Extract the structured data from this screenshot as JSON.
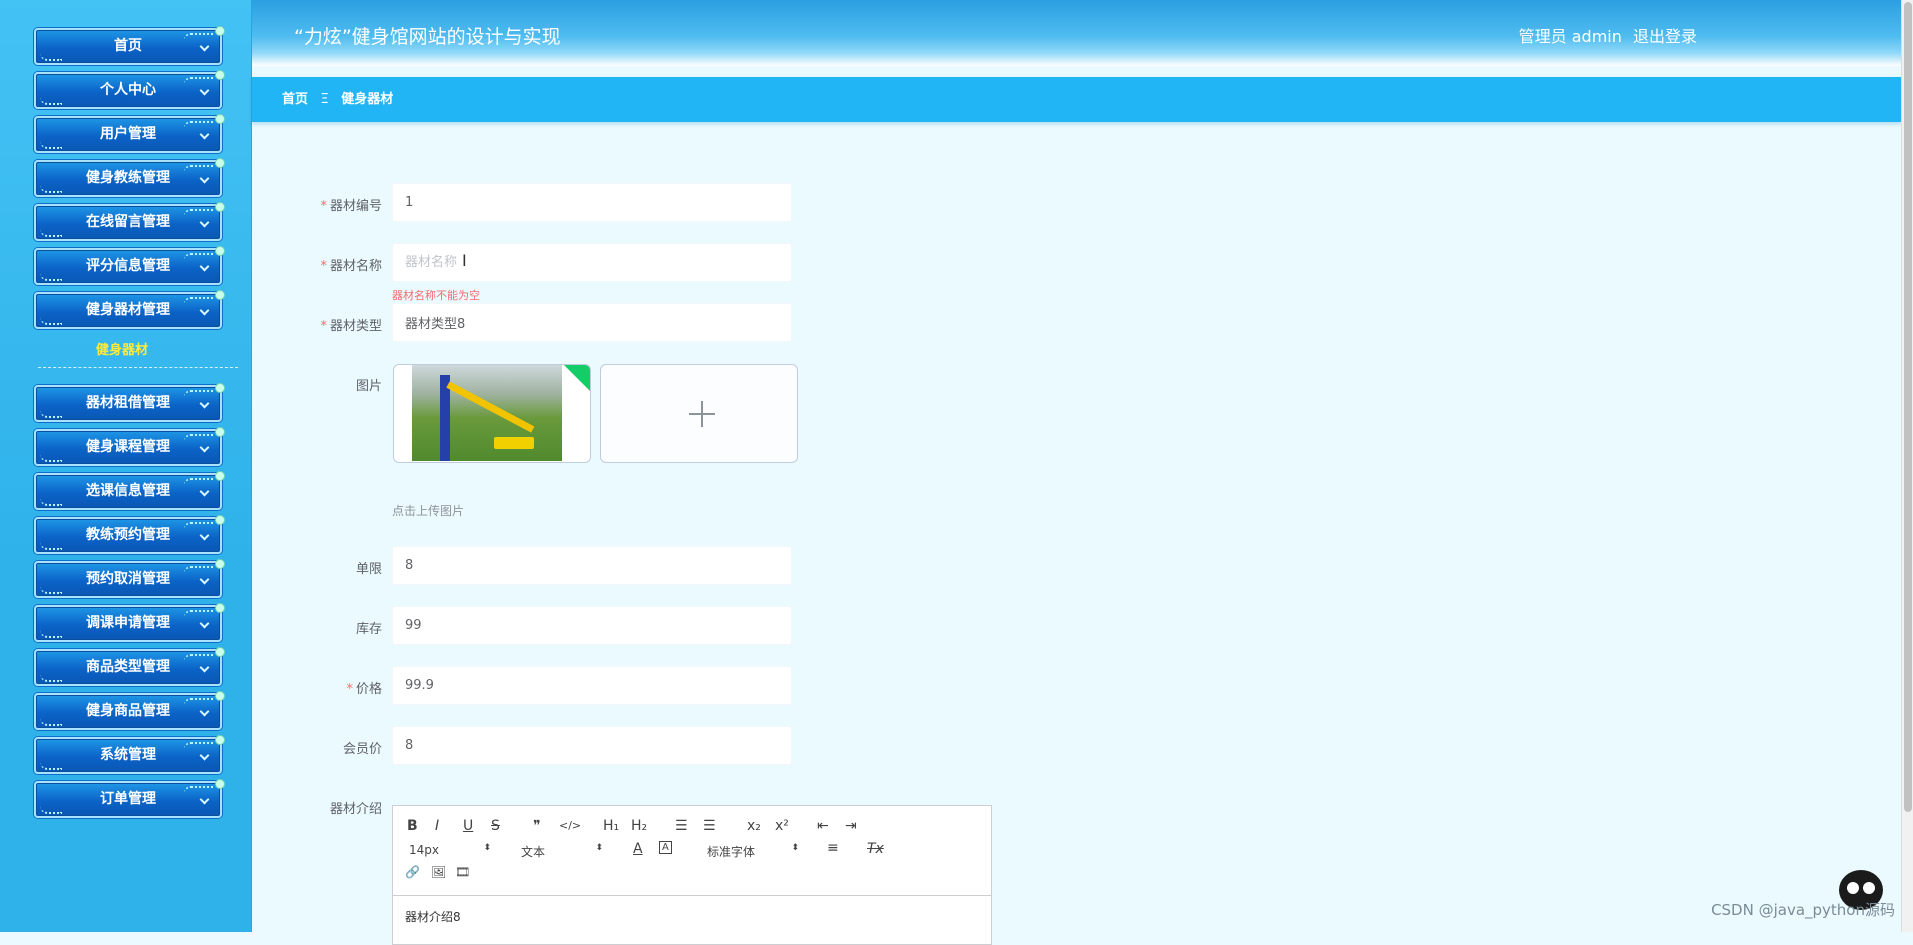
{
  "sidebar": {
    "items": [
      {
        "label": "首页"
      },
      {
        "label": "个人中心"
      },
      {
        "label": "用户管理"
      },
      {
        "label": "健身教练管理"
      },
      {
        "label": "在线留言管理"
      },
      {
        "label": "评分信息管理"
      },
      {
        "label": "健身器材管理"
      },
      {
        "label": "器材租借管理"
      },
      {
        "label": "健身课程管理"
      },
      {
        "label": "选课信息管理"
      },
      {
        "label": "教练预约管理"
      },
      {
        "label": "预约取消管理"
      },
      {
        "label": "调课申请管理"
      },
      {
        "label": "商品类型管理"
      },
      {
        "label": "健身商品管理"
      },
      {
        "label": "系统管理"
      },
      {
        "label": "订单管理"
      }
    ],
    "active_sub_item": "健身器材"
  },
  "header": {
    "title": "“力炫”健身馆网站的设计与实现",
    "user_label": "管理员 admin",
    "logout_label": "退出登录"
  },
  "breadcrumb": {
    "home": "首页",
    "separator": "Ξ",
    "current": "健身器材"
  },
  "form": {
    "equipment_no": {
      "label": "器材编号",
      "value": "1",
      "required": true
    },
    "equipment_name": {
      "label": "器材名称",
      "value": "",
      "placeholder": "器材名称",
      "required": true,
      "error": "器材名称不能为空"
    },
    "equipment_type": {
      "label": "器材类型",
      "value": "器材类型8",
      "required": true
    },
    "image": {
      "label": "图片",
      "upload_tip": "点击上传图片"
    },
    "single_limit": {
      "label": "单限",
      "value": "8"
    },
    "stock": {
      "label": "库存",
      "value": "99"
    },
    "price": {
      "label": "价格",
      "value": "99.9",
      "required": true
    },
    "member_price": {
      "label": "会员价",
      "value": "8"
    },
    "intro": {
      "label": "器材介绍",
      "content": "器材介绍8"
    }
  },
  "editor_toolbar": {
    "bold": "B",
    "italic": "I",
    "underline": "U",
    "strike": "S",
    "quote": "❞",
    "code": "</>",
    "h1": "H₁",
    "h2": "H₂",
    "ordered_list": "☰",
    "bullet_list": "☰",
    "subscript": "x₂",
    "superscript": "x²",
    "outdent": "⇤",
    "indent": "⇥",
    "font_size": "14px",
    "block_type": "文本",
    "font_family": "标准字体",
    "font_color": "A",
    "bg_color": "A",
    "align": "≡",
    "clear": "Tx",
    "link": "🔗",
    "image": "🖼",
    "video": "🎞"
  },
  "watermark": "CSDN @java_python源码",
  "colors": {
    "sidebar_bg": "#2fb2ea",
    "menu_btn": "#0b63c7",
    "breadcrumb_bg": "#22b5f5",
    "page_bg": "#eafaff",
    "required": "#f56c6c",
    "active_sub": "#ffeb3b"
  }
}
